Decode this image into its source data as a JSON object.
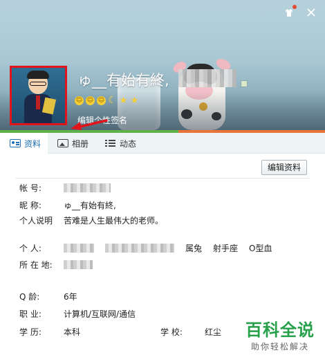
{
  "header": {
    "nickname": "ゅ__有始有終,",
    "signature_edit": "编辑个性签名",
    "icons": [
      "sun-icon",
      "sun-icon",
      "sun-icon",
      "moon-icon",
      "star-icon",
      "star-icon"
    ],
    "window_controls": [
      "skin-icon",
      "close-icon"
    ]
  },
  "tabs": [
    {
      "label": "资料",
      "icon": "profile-card-icon",
      "active": true
    },
    {
      "label": "相册",
      "icon": "photo-album-icon",
      "active": false
    },
    {
      "label": "动态",
      "icon": "feed-list-icon",
      "active": false
    }
  ],
  "edit_button": "编辑资料",
  "profile": {
    "account": {
      "label": "帐    号:"
    },
    "nickname": {
      "label": "昵    称:",
      "value": "ゅ__有始有終,"
    },
    "bio": {
      "label": "个人说明",
      "value": "苦难是人生最伟大的老师。"
    },
    "personal": {
      "label": "个    人:",
      "gender": "属兔",
      "zodiac": "射手座",
      "blood": "O型血"
    },
    "location": {
      "label": "所 在 地:"
    },
    "qage": {
      "label": "Q    龄:",
      "value": "6年"
    },
    "job": {
      "label": "职    业:",
      "value": "计算机/互联网/通信"
    },
    "education": {
      "label": "学    历:",
      "value": "本科"
    },
    "school": {
      "label": "学    校:",
      "value": "红尘"
    }
  },
  "watermark": {
    "title": "百科全说",
    "subtitle": "助你轻松解决"
  },
  "colors": {
    "accent": "#1e6fb8",
    "highlight_frame": "#e2141b",
    "watermark": "#27a04a"
  }
}
